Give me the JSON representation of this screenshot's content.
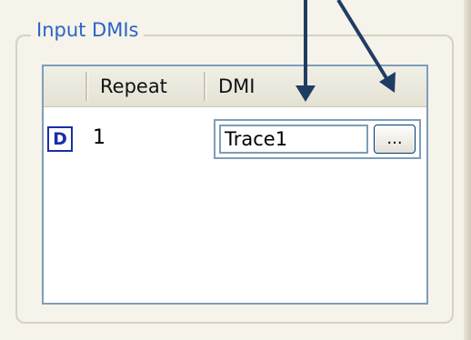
{
  "group": {
    "title": "Input DMIs"
  },
  "grid": {
    "columns": [
      "Repeat",
      "DMI"
    ],
    "rows": [
      {
        "indicator": "D",
        "repeat": "1",
        "dmi": "Trace1"
      }
    ],
    "browse_label": "..."
  },
  "colors": {
    "group_title": "#2b63c6",
    "grid_border": "#7f9db9",
    "arrow": "#1f3d63",
    "indicator": "#1a2ea8"
  }
}
